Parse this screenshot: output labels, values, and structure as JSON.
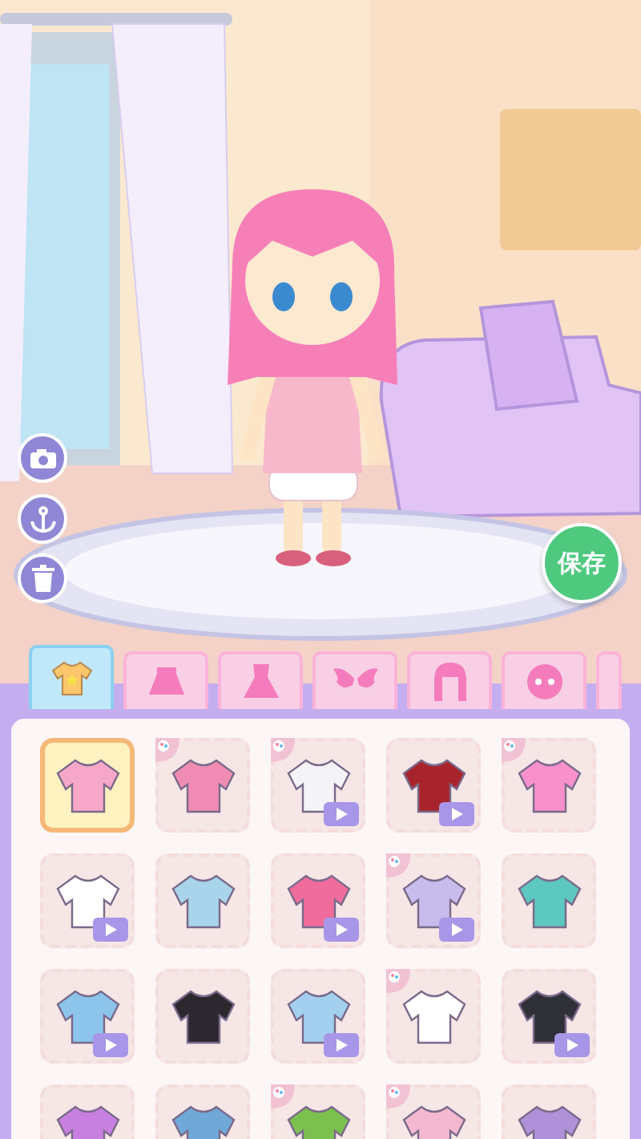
{
  "scene": {
    "save_button": "保存"
  },
  "tabs": [
    {
      "kind": "top",
      "selected": true
    },
    {
      "kind": "skirt",
      "selected": false
    },
    {
      "kind": "dress",
      "selected": false
    },
    {
      "kind": "wings",
      "selected": false
    },
    {
      "kind": "hair",
      "selected": false
    },
    {
      "kind": "face",
      "selected": false
    },
    {
      "kind": "partial",
      "selected": false
    }
  ],
  "items": [
    {
      "selected": true,
      "palette": false,
      "video": false,
      "color": "#f7a8c8"
    },
    {
      "selected": false,
      "palette": true,
      "video": false,
      "color": "#f08cb4"
    },
    {
      "selected": false,
      "palette": true,
      "video": true,
      "color": "#f4f4f8"
    },
    {
      "selected": false,
      "palette": false,
      "video": true,
      "color": "#a8242c"
    },
    {
      "selected": false,
      "palette": true,
      "video": false,
      "color": "#f890cc"
    },
    {
      "selected": false,
      "palette": false,
      "video": true,
      "color": "#ffffff"
    },
    {
      "selected": false,
      "palette": false,
      "video": false,
      "color": "#a8d4ec"
    },
    {
      "selected": false,
      "palette": false,
      "video": true,
      "color": "#f06c9c"
    },
    {
      "selected": false,
      "palette": true,
      "video": true,
      "color": "#c8bcec"
    },
    {
      "selected": false,
      "palette": false,
      "video": false,
      "color": "#5cc8c0"
    },
    {
      "selected": false,
      "palette": false,
      "video": true,
      "color": "#8cc4ec"
    },
    {
      "selected": false,
      "palette": false,
      "video": false,
      "color": "#2c2830"
    },
    {
      "selected": false,
      "palette": false,
      "video": true,
      "color": "#a4d0f0"
    },
    {
      "selected": false,
      "palette": true,
      "video": false,
      "color": "#ffffff"
    },
    {
      "selected": false,
      "palette": false,
      "video": true,
      "color": "#303038"
    },
    {
      "selected": false,
      "palette": false,
      "color": "#c880e0"
    },
    {
      "selected": false,
      "palette": false,
      "color": "#70a8d8"
    },
    {
      "selected": false,
      "palette": true,
      "color": "#7cc050"
    },
    {
      "selected": false,
      "palette": true,
      "color": "#f4b8d0"
    },
    {
      "selected": false,
      "palette": false,
      "color": "#b090d8"
    }
  ]
}
